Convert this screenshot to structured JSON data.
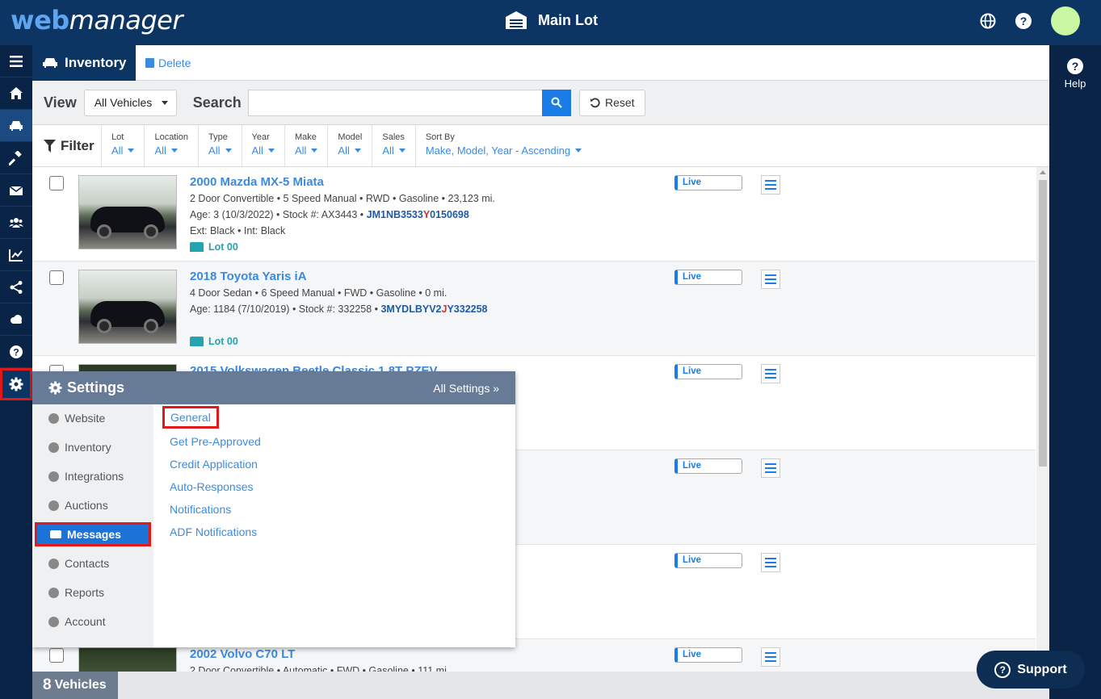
{
  "header": {
    "brand_part1": "web",
    "brand_part2": "manager",
    "location": "Main Lot"
  },
  "toolbar": {
    "tab_label": "Inventory",
    "delete_label": "Delete"
  },
  "view_bar": {
    "view_label": "View",
    "view_value": "All Vehicles",
    "search_label": "Search",
    "search_value": "",
    "reset_label": "Reset"
  },
  "filters": {
    "label": "Filter",
    "columns": [
      {
        "name": "Lot",
        "value": "All"
      },
      {
        "name": "Location",
        "value": "All"
      },
      {
        "name": "Type",
        "value": "All"
      },
      {
        "name": "Year",
        "value": "All"
      },
      {
        "name": "Make",
        "value": "All"
      },
      {
        "name": "Model",
        "value": "All"
      },
      {
        "name": "Sales",
        "value": "All"
      }
    ],
    "sort_label": "Sort By",
    "sort_value": "Make, Model, Year - Ascending"
  },
  "vehicles": [
    {
      "title": "2000 Mazda MX-5 Miata",
      "specs": "2 Door Convertible • 5 Speed Manual • RWD • Gasoline • 23,123 mi.",
      "age_stock": "Age: 3 (10/3/2022) • Stock #: AX3443 • ",
      "vin_a": "JM1NB3533",
      "vin_b": "Y",
      "vin_c": "0150698",
      "colors": "Ext: Black • Int: Black",
      "lot": "Lot 00",
      "status": "Live"
    },
    {
      "title": "2018 Toyota Yaris iA",
      "specs": "4 Door Sedan • 6 Speed Manual • FWD • Gasoline • 0 mi.",
      "age_stock": "Age: 1184 (7/10/2019) • Stock #: 332258 • ",
      "vin_a": "3MYDLBYV2",
      "vin_b": "J",
      "vin_c": "Y332258",
      "lot": "Lot 00",
      "status": "Live"
    },
    {
      "title": "2015 Volkswagen Beetle Classic 1.8T PZEV",
      "status": "Live"
    },
    {
      "status": "Live"
    },
    {
      "status": "Live"
    },
    {
      "title": "2002 Volvo C70 LT",
      "specs": "2 Door Convertible • Automatic • FWD • Gasoline • 111 mi.",
      "status": "Live"
    }
  ],
  "footer": {
    "count_number": "8",
    "count_label": "Vehicles",
    "support_label": "Support"
  },
  "right_panel": {
    "help_label": "Help"
  },
  "settings_popup": {
    "title": "Settings",
    "all_settings": "All Settings »",
    "categories": [
      "Website",
      "Inventory",
      "Integrations",
      "Auctions",
      "Messages",
      "Contacts",
      "Reports",
      "Account"
    ],
    "active_category": "Messages",
    "links": [
      "General",
      "Get Pre-Approved",
      "Credit Application",
      "Auto-Responses",
      "Notifications",
      "ADF Notifications"
    ]
  },
  "colors": {
    "navy": "#0d3564",
    "accent_blue": "#1a7ce6",
    "highlight_red": "#e01919",
    "teal": "#24a3b0"
  },
  "icons": {
    "left_nav": [
      "menu-icon",
      "home-icon",
      "car-icon",
      "gavel-icon",
      "envelope-icon",
      "users-icon",
      "chart-icon",
      "share-icon",
      "cloud-icon",
      "question-icon",
      "gear-icon"
    ]
  }
}
